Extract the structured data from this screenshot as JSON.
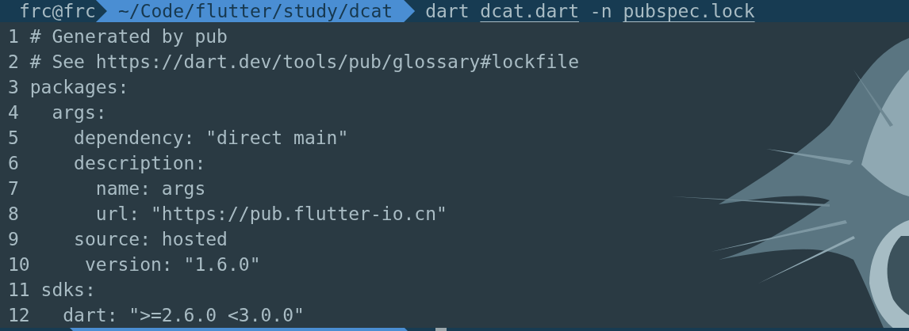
{
  "prompt": {
    "user": "frc@frc",
    "path": "~/Code/flutter/study/dcat",
    "command": [
      {
        "text": "dart",
        "underlined": false
      },
      {
        "text": "dcat.dart",
        "underlined": true
      },
      {
        "text": "-n",
        "underlined": false
      },
      {
        "text": "pubspec.lock",
        "underlined": true
      }
    ]
  },
  "output_lines": [
    {
      "number": "1",
      "text": "# Generated by pub"
    },
    {
      "number": "2",
      "text": "# See https://dart.dev/tools/pub/glossary#lockfile"
    },
    {
      "number": "3",
      "text": "packages:"
    },
    {
      "number": "4",
      "text": "  args:"
    },
    {
      "number": "5",
      "text": "    dependency: \"direct main\""
    },
    {
      "number": "6",
      "text": "    description:"
    },
    {
      "number": "7",
      "text": "      name: args"
    },
    {
      "number": "8",
      "text": "      url: \"https://pub.flutter-io.cn\""
    },
    {
      "number": "9",
      "text": "    source: hosted"
    },
    {
      "number": "10",
      "text": "    version: \"1.6.0\""
    },
    {
      "number": "11",
      "text": "sdks:"
    },
    {
      "number": "12",
      "text": "  dart: \">=2.6.0 <3.0.0\""
    }
  ]
}
